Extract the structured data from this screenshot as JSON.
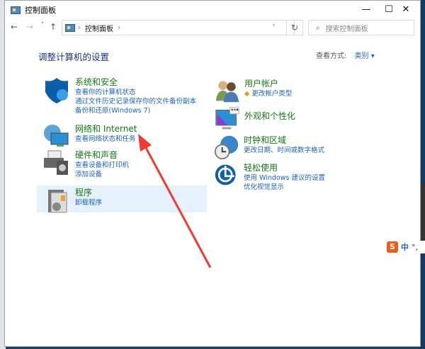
{
  "window": {
    "title": "控制面板",
    "minimize": "—",
    "maximize": "☐",
    "close": "✕"
  },
  "nav": {
    "back": "←",
    "forward": "→",
    "recent": "˅",
    "up": "↑",
    "breadcrumb": "控制面板",
    "sep": "›",
    "dropdown": "˅",
    "refresh": "↻",
    "search_placeholder": "搜索控制面板",
    "search_icon": "⌕"
  },
  "main": {
    "heading": "调整计算机的设置",
    "view_by_label": "查看方式:",
    "view_by_value": "类别",
    "categories": [
      {
        "title": "系统和安全",
        "links": [
          "查看你的计算机状态",
          "通过文件历史记录保存你的文件备份副本",
          "备份和还原(Windows 7)"
        ]
      },
      {
        "title": "网络和 Internet",
        "links": [
          "查看网络状态和任务"
        ]
      },
      {
        "title": "硬件和声音",
        "links": [
          "查看设备和打印机",
          "添加设备"
        ]
      },
      {
        "title": "程序",
        "links": [
          "卸载程序"
        ]
      },
      {
        "title": "用户帐户",
        "links": [
          "更改帐户类型"
        ]
      },
      {
        "title": "外观和个性化",
        "links": []
      },
      {
        "title": "时钟和区域",
        "links": [
          "更改日期、时间或数字格式"
        ]
      },
      {
        "title": "轻松使用",
        "links": [
          "使用 Windows 建议的设置",
          "优化视觉显示"
        ]
      }
    ]
  },
  "ime": {
    "logo": "S",
    "mode": "中",
    "punct": "°,"
  },
  "colors": {
    "title": "#147a14",
    "link": "#1c62c7",
    "heading": "#1e3287",
    "arrow": "#f03a32"
  }
}
